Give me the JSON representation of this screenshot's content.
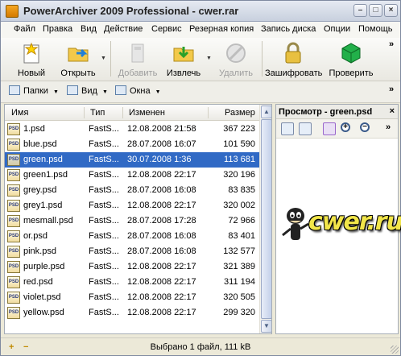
{
  "window": {
    "title": "PowerArchiver 2009 Professional - cwer.rar",
    "controls": [
      "–",
      "□",
      "×"
    ]
  },
  "menu": [
    "Файл",
    "Правка",
    "Вид",
    "Действие",
    "Сервис",
    "Резерная копия",
    "Запись диска",
    "Опции",
    "Помощь"
  ],
  "toolbar": {
    "new": "Новый",
    "open": "Открыть",
    "add": "Добавить",
    "extract": "Извлечь",
    "delete": "Удалить",
    "encrypt": "Зашифровать",
    "verify": "Проверить",
    "more": "»"
  },
  "toolbar2": {
    "folders": "Папки",
    "view": "Вид",
    "windows": "Окна",
    "more": "»"
  },
  "filelist": {
    "columns": {
      "name": "Имя",
      "type": "Тип",
      "modified": "Изменен",
      "size": "Размер"
    },
    "rows": [
      {
        "name": "1.psd",
        "type": "FastS...",
        "modified": "12.08.2008 21:58",
        "size": "367 223",
        "selected": false
      },
      {
        "name": "blue.psd",
        "type": "FastS...",
        "modified": "28.07.2008 16:07",
        "size": "101 590",
        "selected": false
      },
      {
        "name": "green.psd",
        "type": "FastS...",
        "modified": "30.07.2008 1:36",
        "size": "113 681",
        "selected": true
      },
      {
        "name": "green1.psd",
        "type": "FastS...",
        "modified": "12.08.2008 22:17",
        "size": "320 196",
        "selected": false
      },
      {
        "name": "grey.psd",
        "type": "FastS...",
        "modified": "28.07.2008 16:08",
        "size": "83 835",
        "selected": false
      },
      {
        "name": "grey1.psd",
        "type": "FastS...",
        "modified": "12.08.2008 22:17",
        "size": "320 002",
        "selected": false
      },
      {
        "name": "mesmall.psd",
        "type": "FastS...",
        "modified": "28.07.2008 17:28",
        "size": "72 966",
        "selected": false
      },
      {
        "name": "or.psd",
        "type": "FastS...",
        "modified": "28.07.2008 16:08",
        "size": "83 401",
        "selected": false
      },
      {
        "name": "pink.psd",
        "type": "FastS...",
        "modified": "28.07.2008 16:08",
        "size": "132 577",
        "selected": false
      },
      {
        "name": "purple.psd",
        "type": "FastS...",
        "modified": "12.08.2008 22:17",
        "size": "321 389",
        "selected": false
      },
      {
        "name": "red.psd",
        "type": "FastS...",
        "modified": "12.08.2008 22:17",
        "size": "311 194",
        "selected": false
      },
      {
        "name": "violet.psd",
        "type": "FastS...",
        "modified": "12.08.2008 22:17",
        "size": "320 505",
        "selected": false
      },
      {
        "name": "yellow.psd",
        "type": "FastS...",
        "modified": "12.08.2008 22:17",
        "size": "299 320",
        "selected": false
      }
    ],
    "icon_label": "PSD"
  },
  "preview": {
    "title": "Просмотр - green.psd",
    "close": "×",
    "more": "»",
    "logo_text": "cwer.ru"
  },
  "status": {
    "text": "Выбрано 1 файл, 111 kB",
    "add_icon": "+",
    "remove_icon": "−"
  },
  "colors": {
    "selection": "#316ac5",
    "logo_yellow": "#f2e64a"
  }
}
